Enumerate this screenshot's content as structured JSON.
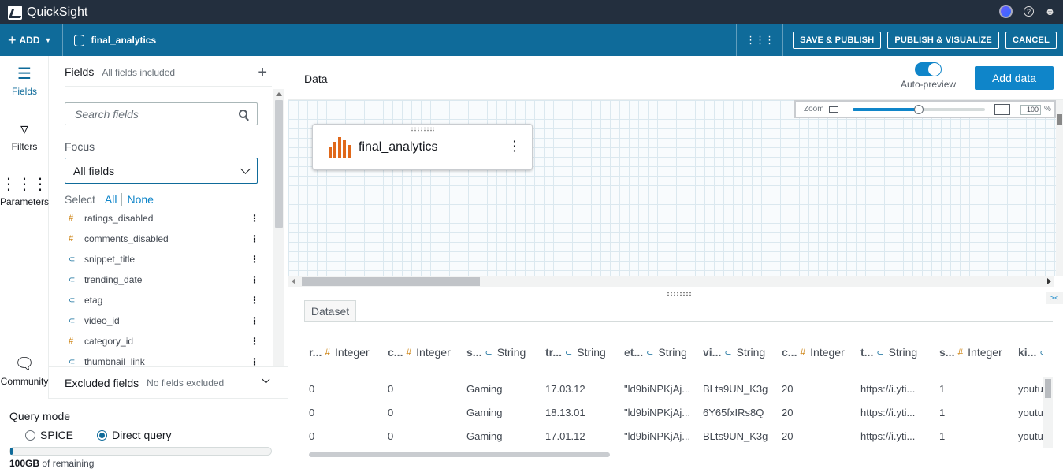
{
  "app": {
    "title": "QuickSight"
  },
  "toolbar": {
    "add_label": "ADD",
    "dataset_name": "final_analytics",
    "buttons": {
      "save_publish": "SAVE & PUBLISH",
      "publish_visualize": "PUBLISH & VISUALIZE",
      "cancel": "CANCEL"
    }
  },
  "leftnav": {
    "items": [
      {
        "label": "Fields",
        "icon": "fields-icon"
      },
      {
        "label": "Filters",
        "icon": "filter-icon"
      },
      {
        "label": "Parameters",
        "icon": "parameters-icon"
      },
      {
        "label": "Community",
        "icon": "community-icon"
      }
    ]
  },
  "fields_panel": {
    "title": "Fields",
    "subtitle": "All fields included",
    "search_placeholder": "Search fields",
    "focus_label": "Focus",
    "focus_value": "All fields",
    "select_label": "Select",
    "select_all": "All",
    "select_none": "None",
    "fields": [
      {
        "name": "ratings_disabled",
        "type": "number"
      },
      {
        "name": "comments_disabled",
        "type": "number"
      },
      {
        "name": "snippet_title",
        "type": "string"
      },
      {
        "name": "trending_date",
        "type": "string"
      },
      {
        "name": "etag",
        "type": "string"
      },
      {
        "name": "video_id",
        "type": "string"
      },
      {
        "name": "category_id",
        "type": "number"
      },
      {
        "name": "thumbnail_link",
        "type": "string"
      }
    ]
  },
  "excluded": {
    "title": "Excluded fields",
    "subtitle": "No fields excluded"
  },
  "query": {
    "title": "Query mode",
    "spice": "SPICE",
    "direct": "Direct query",
    "selected": "direct",
    "capacity_value": "100GB",
    "capacity_text": " of remaining",
    "capacity_used": 0.01
  },
  "data_view": {
    "title": "Data",
    "auto_preview": "Auto-preview",
    "add_data": "Add data",
    "zoom_label": "Zoom",
    "zoom_value": "100",
    "zoom_unit": "%",
    "zoom_slider": 0.5,
    "node_name": "final_analytics"
  },
  "dataset": {
    "tab": "Dataset",
    "columns": [
      {
        "short": "r...",
        "type": "Integer",
        "kind": "number"
      },
      {
        "short": "c...",
        "type": "Integer",
        "kind": "number"
      },
      {
        "short": "s...",
        "type": "String",
        "kind": "string"
      },
      {
        "short": "tr...",
        "type": "String",
        "kind": "string"
      },
      {
        "short": "et...",
        "type": "String",
        "kind": "string"
      },
      {
        "short": "vi...",
        "type": "String",
        "kind": "string"
      },
      {
        "short": "c...",
        "type": "Integer",
        "kind": "number"
      },
      {
        "short": "t...",
        "type": "String",
        "kind": "string"
      },
      {
        "short": "s...",
        "type": "Integer",
        "kind": "number"
      },
      {
        "short": "ki...",
        "type": "",
        "kind": "string"
      }
    ],
    "rows": [
      [
        "0",
        "0",
        "Gaming",
        "17.03.12",
        "\"ld9biNPKjAj...",
        "BLts9UN_K3g",
        "20",
        "https://i.yti...",
        "1",
        "youtu"
      ],
      [
        "0",
        "0",
        "Gaming",
        "18.13.01",
        "\"ld9biNPKjAj...",
        "6Y65fxIRs8Q",
        "20",
        "https://i.yti...",
        "1",
        "youtu"
      ],
      [
        "0",
        "0",
        "Gaming",
        "17.01.12",
        "\"ld9biNPKjAj...",
        "BLts9UN_K3g",
        "20",
        "https://i.yti...",
        "1",
        "youtu"
      ]
    ]
  },
  "colors": {
    "topbar": "#232f3e",
    "toolbar": "#0f6b9a",
    "accent": "#0f85c9"
  }
}
